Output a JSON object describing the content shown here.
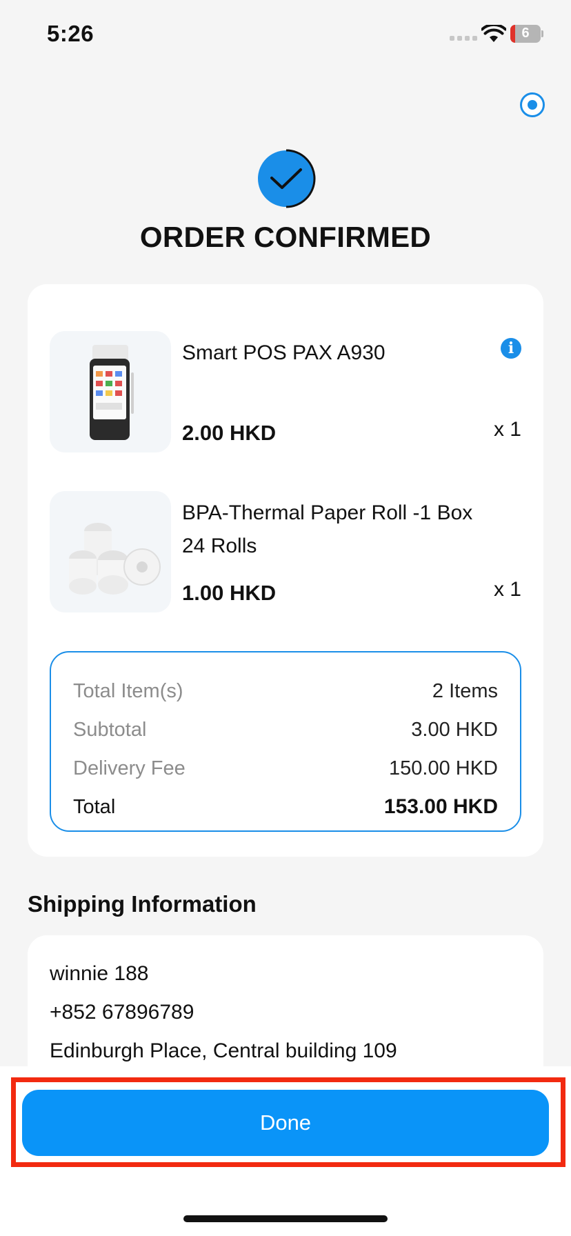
{
  "status_bar": {
    "time": "5:26",
    "battery_level": "6"
  },
  "header": {
    "title": "ORDER CONFIRMED"
  },
  "order": {
    "items": [
      {
        "name": "Smart POS PAX A930",
        "price": "2.00 HKD",
        "qty": "x 1",
        "image": "pos-terminal-image"
      },
      {
        "name": "BPA-Thermal Paper Roll -1 Box 24 Rolls",
        "price": "1.00 HKD",
        "qty": "x 1",
        "image": "paper-rolls-image"
      }
    ],
    "summary": {
      "total_items_label": "Total Item(s)",
      "total_items_value": "2 Items",
      "subtotal_label": "Subtotal",
      "subtotal_value": "3.00 HKD",
      "delivery_label": "Delivery Fee",
      "delivery_value": "150.00 HKD",
      "total_label": "Total",
      "total_value": "153.00 HKD"
    }
  },
  "shipping": {
    "heading": "Shipping Information",
    "name": "winnie 188",
    "phone": "+852 67896789",
    "address": "Edinburgh Place, Central building 109"
  },
  "actions": {
    "done_label": "Done"
  },
  "colors": {
    "accent": "#0a94f8",
    "highlight": "#f22a10",
    "background": "#f5f5f5"
  }
}
